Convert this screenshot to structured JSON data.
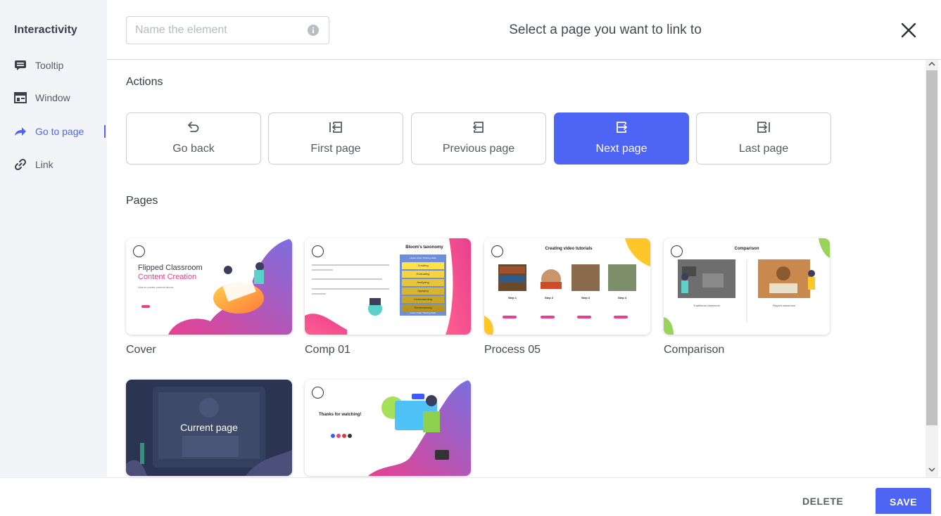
{
  "sidebar": {
    "title": "Interactivity",
    "items": [
      {
        "label": "Tooltip",
        "icon": "tooltip-icon"
      },
      {
        "label": "Window",
        "icon": "window-icon"
      },
      {
        "label": "Go to page",
        "icon": "go-to-page-icon",
        "active": true
      },
      {
        "label": "Link",
        "icon": "link-icon"
      }
    ]
  },
  "header": {
    "name_placeholder": "Name the element",
    "title": "Select a page you want to link to"
  },
  "actions": {
    "section_label": "Actions",
    "items": [
      {
        "label": "Go back",
        "icon": "go-back-icon"
      },
      {
        "label": "First page",
        "icon": "first-page-icon"
      },
      {
        "label": "Previous page",
        "icon": "previous-page-icon"
      },
      {
        "label": "Next page",
        "icon": "next-page-icon",
        "selected": true
      },
      {
        "label": "Last page",
        "icon": "last-page-icon"
      }
    ]
  },
  "pages": {
    "section_label": "Pages",
    "items": [
      {
        "name": "Cover",
        "preview": {
          "line1": "Flipped Classroom",
          "line2": "Content Creation",
          "subtitle": "How to create content about"
        }
      },
      {
        "name": "Comp 01",
        "preview": {
          "title": "Bloom's taxonomy",
          "top": "Higher Order Thinking Skills",
          "levels": [
            "Creating",
            "Evaluating",
            "Analyzing",
            "Applying",
            "Understanding",
            "Remembering"
          ],
          "bottom": "Lower Order Thinking Skills"
        }
      },
      {
        "name": "Process 05",
        "preview": {
          "title": "Creating video tutorials",
          "steps": [
            "Step 1",
            "Step 2",
            "Step 3",
            "Step 4"
          ]
        }
      },
      {
        "name": "Comparison",
        "preview": {
          "title": "Comparison",
          "left": "Traditional classroom",
          "right": "Flipped classroom"
        }
      },
      {
        "name": "",
        "current_label": "Current page"
      },
      {
        "name": "",
        "preview": {
          "title": "Thanks for watching!"
        }
      }
    ]
  },
  "footer": {
    "delete_label": "DELETE",
    "save_label": "SAVE"
  },
  "colors": {
    "accent": "#4d64f5",
    "sidebar_bg": "#f3f4f8",
    "pink": "#e8408f",
    "purple": "#8a5cd6"
  }
}
